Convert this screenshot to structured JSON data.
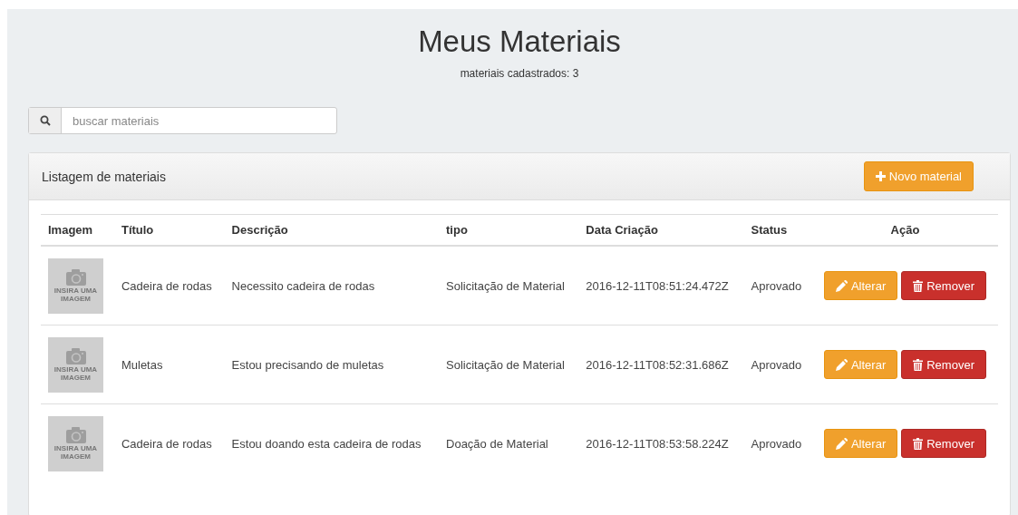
{
  "page": {
    "title": "Meus Materiais",
    "subtitle": "materiais cadastrados: 3"
  },
  "search": {
    "placeholder": "buscar materiais"
  },
  "panel": {
    "title": "Listagem de materiais",
    "new_button": "Novo material"
  },
  "table": {
    "columns": [
      "Imagem",
      "Título",
      "Descrição",
      "tipo",
      "Data Criação",
      "Status",
      "Ação"
    ],
    "rows": [
      {
        "image_text": "INSIRA UMA IMAGEM",
        "title": "Cadeira de rodas",
        "description": "Necessito cadeira de rodas",
        "type": "Solicitação de Material",
        "created": "2016-12-11T08:51:24.472Z",
        "status": "Aprovado",
        "edit": "Alterar",
        "remove": "Remover"
      },
      {
        "image_text": "INSIRA UMA IMAGEM",
        "title": "Muletas",
        "description": "Estou precisando de muletas",
        "type": "Solicitação de Material",
        "created": "2016-12-11T08:52:31.686Z",
        "status": "Aprovado",
        "edit": "Alterar",
        "remove": "Remover"
      },
      {
        "image_text": "INSIRA UMA IMAGEM",
        "title": "Cadeira de rodas",
        "description": "Estou doando esta cadeira de rodas",
        "type": "Doação de Material",
        "created": "2016-12-11T08:53:58.224Z",
        "status": "Aprovado",
        "edit": "Alterar",
        "remove": "Remover"
      }
    ]
  }
}
